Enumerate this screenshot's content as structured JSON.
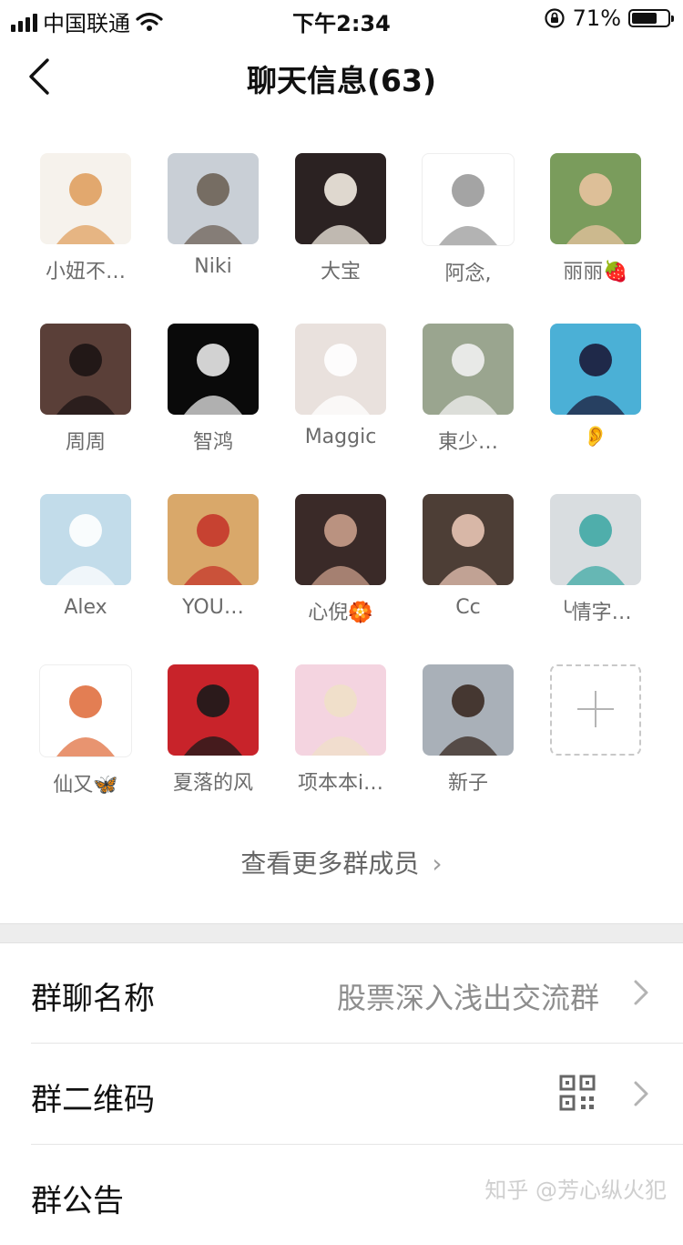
{
  "status_bar": {
    "carrier": "中国联通",
    "time": "下午2:34",
    "battery": "71%",
    "battery_level": 0.71
  },
  "nav": {
    "title": "聊天信息(63)"
  },
  "members": [
    {
      "name": "小妞不…",
      "bg": "#f6f2ec",
      "accent": "#e0a060"
    },
    {
      "name": "Niki",
      "bg": "#c9cfd6",
      "accent": "#6d6257"
    },
    {
      "name": "大宝",
      "bg": "#2b2222",
      "accent": "#f3ece2"
    },
    {
      "name": "阿念,",
      "bg": "#ffffff",
      "accent": "#9a9a9a"
    },
    {
      "name": "丽丽🍓",
      "bg": "#7a9c5c",
      "accent": "#e8c39f"
    },
    {
      "name": "周周",
      "bg": "#5a3f38",
      "accent": "#1c1414"
    },
    {
      "name": "智鸿",
      "bg": "#0a0a0a",
      "accent": "#e8e8e8"
    },
    {
      "name": "Maggic",
      "bg": "#e9e1dd",
      "accent": "#ffffff"
    },
    {
      "name": "東少…",
      "bg": "#9aa58f",
      "accent": "#f1f1f1"
    },
    {
      "name": "👂",
      "bg": "#4bb0d6",
      "accent": "#1b1b3a"
    },
    {
      "name": "Alex",
      "bg": "#c2dcea",
      "accent": "#ffffff"
    },
    {
      "name": "YOU…",
      "bg": "#d9a86a",
      "accent": "#c4362b"
    },
    {
      "name": "心倪🏵️",
      "bg": "#3a2a28",
      "accent": "#c99d8a"
    },
    {
      "name": "Cc",
      "bg": "#4d3e36",
      "accent": "#e8c4b4"
    },
    {
      "name": "╰情字…",
      "bg": "#d9dde0",
      "accent": "#3fa9a5"
    },
    {
      "name": "仙又🦋",
      "bg": "#ffffff",
      "accent": "#e07040"
    },
    {
      "name": "夏落的风",
      "bg": "#c8232a",
      "accent": "#1a1a1a"
    },
    {
      "name": "项本本i…",
      "bg": "#f4d4e0",
      "accent": "#f0e0c8"
    },
    {
      "name": "新子",
      "bg": "#a9b0b8",
      "accent": "#3a2a22"
    }
  ],
  "view_more": {
    "label": "查看更多群成员",
    "chevron": "›"
  },
  "settings": {
    "group_name_label": "群聊名称",
    "group_name_value": "股票深入浅出交流群",
    "qr_label": "群二维码",
    "announcement_label": "群公告"
  },
  "icons": {
    "back": "chevron-left-icon",
    "add": "plus-icon",
    "qr": "qrcode-icon",
    "chevron": "chevron-right-icon"
  },
  "watermark": "知乎 @芳心纵火犯"
}
